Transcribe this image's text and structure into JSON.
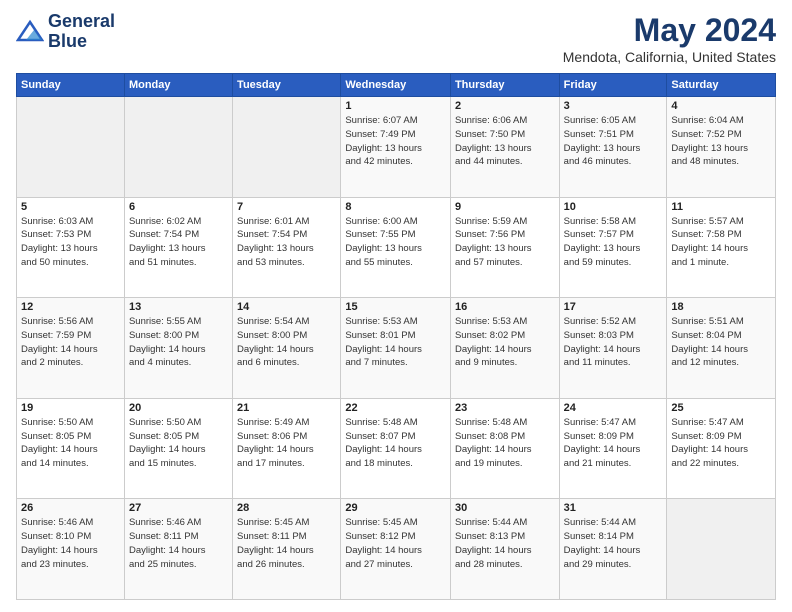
{
  "header": {
    "logo_line1": "General",
    "logo_line2": "Blue",
    "month": "May 2024",
    "location": "Mendota, California, United States"
  },
  "days_of_week": [
    "Sunday",
    "Monday",
    "Tuesday",
    "Wednesday",
    "Thursday",
    "Friday",
    "Saturday"
  ],
  "weeks": [
    [
      {
        "day": "",
        "info": ""
      },
      {
        "day": "",
        "info": ""
      },
      {
        "day": "",
        "info": ""
      },
      {
        "day": "1",
        "info": "Sunrise: 6:07 AM\nSunset: 7:49 PM\nDaylight: 13 hours\nand 42 minutes."
      },
      {
        "day": "2",
        "info": "Sunrise: 6:06 AM\nSunset: 7:50 PM\nDaylight: 13 hours\nand 44 minutes."
      },
      {
        "day": "3",
        "info": "Sunrise: 6:05 AM\nSunset: 7:51 PM\nDaylight: 13 hours\nand 46 minutes."
      },
      {
        "day": "4",
        "info": "Sunrise: 6:04 AM\nSunset: 7:52 PM\nDaylight: 13 hours\nand 48 minutes."
      }
    ],
    [
      {
        "day": "5",
        "info": "Sunrise: 6:03 AM\nSunset: 7:53 PM\nDaylight: 13 hours\nand 50 minutes."
      },
      {
        "day": "6",
        "info": "Sunrise: 6:02 AM\nSunset: 7:54 PM\nDaylight: 13 hours\nand 51 minutes."
      },
      {
        "day": "7",
        "info": "Sunrise: 6:01 AM\nSunset: 7:54 PM\nDaylight: 13 hours\nand 53 minutes."
      },
      {
        "day": "8",
        "info": "Sunrise: 6:00 AM\nSunset: 7:55 PM\nDaylight: 13 hours\nand 55 minutes."
      },
      {
        "day": "9",
        "info": "Sunrise: 5:59 AM\nSunset: 7:56 PM\nDaylight: 13 hours\nand 57 minutes."
      },
      {
        "day": "10",
        "info": "Sunrise: 5:58 AM\nSunset: 7:57 PM\nDaylight: 13 hours\nand 59 minutes."
      },
      {
        "day": "11",
        "info": "Sunrise: 5:57 AM\nSunset: 7:58 PM\nDaylight: 14 hours\nand 1 minute."
      }
    ],
    [
      {
        "day": "12",
        "info": "Sunrise: 5:56 AM\nSunset: 7:59 PM\nDaylight: 14 hours\nand 2 minutes."
      },
      {
        "day": "13",
        "info": "Sunrise: 5:55 AM\nSunset: 8:00 PM\nDaylight: 14 hours\nand 4 minutes."
      },
      {
        "day": "14",
        "info": "Sunrise: 5:54 AM\nSunset: 8:00 PM\nDaylight: 14 hours\nand 6 minutes."
      },
      {
        "day": "15",
        "info": "Sunrise: 5:53 AM\nSunset: 8:01 PM\nDaylight: 14 hours\nand 7 minutes."
      },
      {
        "day": "16",
        "info": "Sunrise: 5:53 AM\nSunset: 8:02 PM\nDaylight: 14 hours\nand 9 minutes."
      },
      {
        "day": "17",
        "info": "Sunrise: 5:52 AM\nSunset: 8:03 PM\nDaylight: 14 hours\nand 11 minutes."
      },
      {
        "day": "18",
        "info": "Sunrise: 5:51 AM\nSunset: 8:04 PM\nDaylight: 14 hours\nand 12 minutes."
      }
    ],
    [
      {
        "day": "19",
        "info": "Sunrise: 5:50 AM\nSunset: 8:05 PM\nDaylight: 14 hours\nand 14 minutes."
      },
      {
        "day": "20",
        "info": "Sunrise: 5:50 AM\nSunset: 8:05 PM\nDaylight: 14 hours\nand 15 minutes."
      },
      {
        "day": "21",
        "info": "Sunrise: 5:49 AM\nSunset: 8:06 PM\nDaylight: 14 hours\nand 17 minutes."
      },
      {
        "day": "22",
        "info": "Sunrise: 5:48 AM\nSunset: 8:07 PM\nDaylight: 14 hours\nand 18 minutes."
      },
      {
        "day": "23",
        "info": "Sunrise: 5:48 AM\nSunset: 8:08 PM\nDaylight: 14 hours\nand 19 minutes."
      },
      {
        "day": "24",
        "info": "Sunrise: 5:47 AM\nSunset: 8:09 PM\nDaylight: 14 hours\nand 21 minutes."
      },
      {
        "day": "25",
        "info": "Sunrise: 5:47 AM\nSunset: 8:09 PM\nDaylight: 14 hours\nand 22 minutes."
      }
    ],
    [
      {
        "day": "26",
        "info": "Sunrise: 5:46 AM\nSunset: 8:10 PM\nDaylight: 14 hours\nand 23 minutes."
      },
      {
        "day": "27",
        "info": "Sunrise: 5:46 AM\nSunset: 8:11 PM\nDaylight: 14 hours\nand 25 minutes."
      },
      {
        "day": "28",
        "info": "Sunrise: 5:45 AM\nSunset: 8:11 PM\nDaylight: 14 hours\nand 26 minutes."
      },
      {
        "day": "29",
        "info": "Sunrise: 5:45 AM\nSunset: 8:12 PM\nDaylight: 14 hours\nand 27 minutes."
      },
      {
        "day": "30",
        "info": "Sunrise: 5:44 AM\nSunset: 8:13 PM\nDaylight: 14 hours\nand 28 minutes."
      },
      {
        "day": "31",
        "info": "Sunrise: 5:44 AM\nSunset: 8:14 PM\nDaylight: 14 hours\nand 29 minutes."
      },
      {
        "day": "",
        "info": ""
      }
    ]
  ]
}
